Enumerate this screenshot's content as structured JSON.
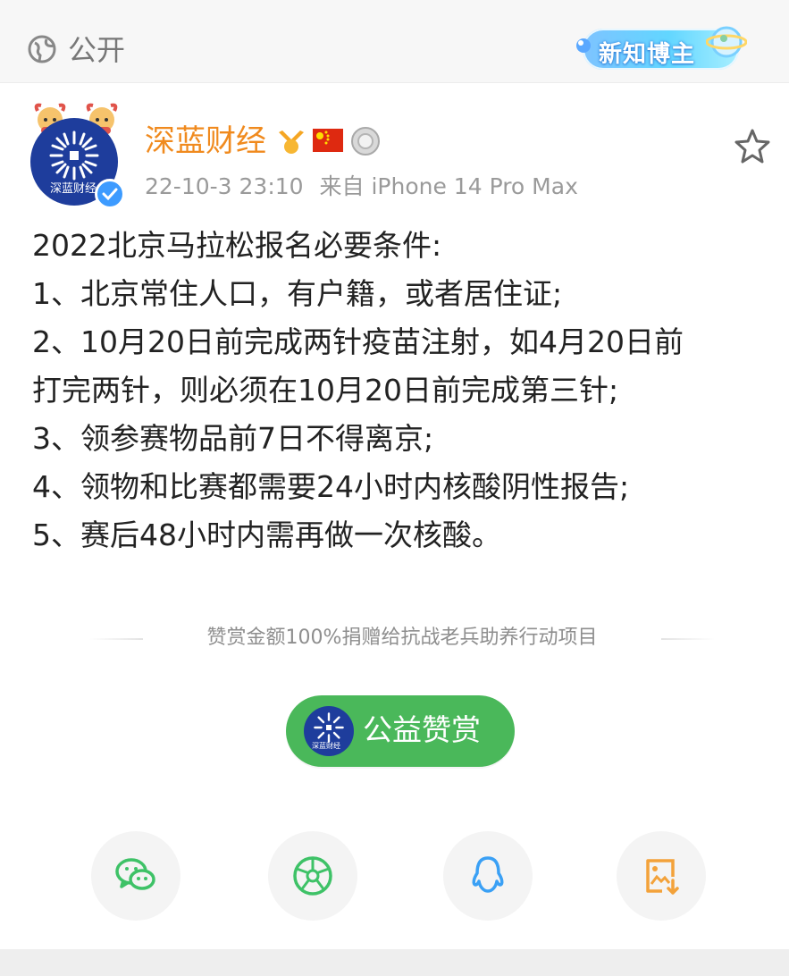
{
  "header": {
    "visibility_label": "公开",
    "badge_label": "新知博主"
  },
  "post": {
    "account_name": "深蓝财经",
    "avatar_caption": "深蓝财经",
    "timestamp": "22-10-3 23:10",
    "source": "来自 iPhone 14 Pro Max",
    "lines": [
      "2022北京马拉松报名必要条件:",
      "1、北京常住人口，有户籍，或者居住证;",
      "2、10月20日前完成两针疫苗注射，如4月20日前",
      "打完两针，则必须在10月20日前完成第三针;",
      "3、领参赛物品前7日不得离京;",
      "4、领物和比赛都需要24小时内核酸阴性报告;",
      "5、赛后48小时内需再做一次核酸。"
    ]
  },
  "reward": {
    "note": "赞赏金额100%捐赠给抗战老兵助养行动项目",
    "button_label": "公益赞赏"
  },
  "share": {
    "items": [
      "wechat-icon",
      "moments-icon",
      "qq-icon",
      "save-image-icon"
    ]
  },
  "colors": {
    "accent_orange": "#f08a1e",
    "reward_green": "#4ab85a",
    "verified_blue": "#3d9bff",
    "avatar_navy": "#1e3d9c"
  }
}
